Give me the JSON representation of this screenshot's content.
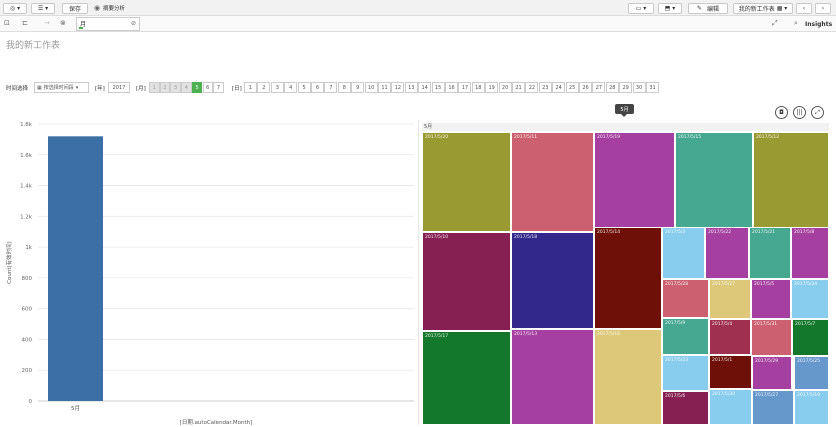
{
  "toolbar": {
    "save_label": "保存",
    "bookmark_label": "摘要分析",
    "edit_label": "编辑",
    "sheet_select": "我的新工作表"
  },
  "subbar": {
    "tab_label": "月",
    "insights_label": "Insights"
  },
  "sheet": {
    "title": "我的新工作表"
  },
  "filter": {
    "label": "时间选择",
    "dropdown_value": "按选择时间段",
    "year_label": "[年]",
    "year_value": "2017",
    "month_label": "[月]",
    "months": [
      "1",
      "2",
      "3",
      "4",
      "5",
      "6",
      "7"
    ],
    "selected_month": "5",
    "day_label": "[日]",
    "days": [
      "1",
      "2",
      "3",
      "4",
      "5",
      "6",
      "7",
      "8",
      "9",
      "10",
      "11",
      "12",
      "13",
      "14",
      "15",
      "16",
      "17",
      "18",
      "19",
      "20",
      "21",
      "22",
      "23",
      "24",
      "25",
      "26",
      "27",
      "28",
      "29",
      "30",
      "31"
    ]
  },
  "tooltip": {
    "text": "5月"
  },
  "chart_data": {
    "type": "bar",
    "categories": [
      "5月"
    ],
    "values": [
      1720
    ],
    "xlabel": "[日期.autoCalendar.Month]",
    "ylabel": "Count(有效时间)",
    "ylim": [
      0,
      1800
    ],
    "yticks": [
      0,
      200,
      400,
      600,
      800,
      1000,
      1200,
      1400,
      1600,
      1800
    ],
    "ytick_labels": [
      "0",
      "200",
      "400",
      "600",
      "800",
      "1k",
      "1.2k",
      "1.4k",
      "1.6k",
      "1.8k"
    ],
    "bar_color": "#3b6fa6",
    "grid": true
  },
  "treemap": {
    "header": "5月",
    "cells": [
      {
        "label": "2017/5/20",
        "color": "#9a9a32"
      },
      {
        "label": "2017/5/11",
        "color": "#cc6070"
      },
      {
        "label": "2017/5/19",
        "color": "#a640a0"
      },
      {
        "label": "2017/5/15",
        "color": "#46a890"
      },
      {
        "label": "2017/5/12",
        "color": "#9a9a32"
      },
      {
        "label": "2017/5/10",
        "color": "#862052"
      },
      {
        "label": "2017/5/18",
        "color": "#32288c"
      },
      {
        "label": "2017/5/14",
        "color": "#6e1008"
      },
      {
        "label": "2017/5/3",
        "color": "#88ccee"
      },
      {
        "label": "2017/5/22",
        "color": "#a640a0"
      },
      {
        "label": "2017/5/21",
        "color": "#46a890"
      },
      {
        "label": "2017/5/8",
        "color": "#a640a0"
      },
      {
        "label": "2017/5/28",
        "color": "#cc6070"
      },
      {
        "label": "2017/5/27",
        "color": "#dcc878"
      },
      {
        "label": "2017/5/5",
        "color": "#a640a0"
      },
      {
        "label": "2017/5/24",
        "color": "#88ccee"
      },
      {
        "label": "2017/5/17",
        "color": "#14782c"
      },
      {
        "label": "2017/5/13",
        "color": "#a640a0"
      },
      {
        "label": "2017/5/16",
        "color": "#dcc878"
      },
      {
        "label": "2017/5/9",
        "color": "#46a890"
      },
      {
        "label": "2017/5/4",
        "color": "#a03050"
      },
      {
        "label": "2017/5/31",
        "color": "#cc6070"
      },
      {
        "label": "2017/5/7",
        "color": "#14782c"
      },
      {
        "label": "2017/5/23",
        "color": "#88ccee"
      },
      {
        "label": "2017/5/1",
        "color": "#6e1008"
      },
      {
        "label": "2017/5/29",
        "color": "#a640a0"
      },
      {
        "label": "2017/5/25",
        "color": "#6698cc"
      },
      {
        "label": "2017/5/6",
        "color": "#862052"
      },
      {
        "label": "2017/5/30",
        "color": "#88ccee"
      },
      {
        "label": "2017/5/27",
        "color": "#6698cc"
      },
      {
        "label": "2017/5/19",
        "color": "#88ccee"
      }
    ]
  }
}
